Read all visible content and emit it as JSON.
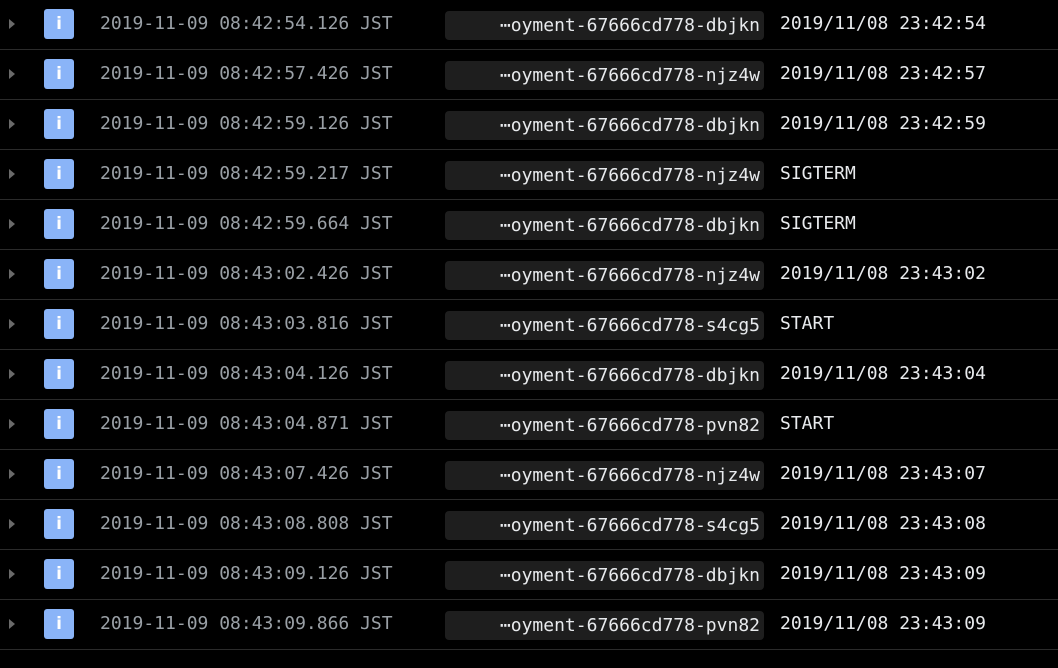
{
  "theme": {
    "background": "#000000",
    "severity_info_color": "#8ab4f8",
    "timestamp_color": "#9aa0a6",
    "text_color": "#e8eaed",
    "chip_background": "#1e1e1e"
  },
  "icons": {
    "expand": "chevron-right-icon",
    "severity": "info-icon"
  },
  "log_entries": [
    {
      "severity_glyph": "i",
      "timestamp": "2019-11-09 08:42:54.126 JST",
      "pod": "⋯oyment-67666cd778-dbjkn",
      "message": "2019/11/08 23:42:54"
    },
    {
      "severity_glyph": "i",
      "timestamp": "2019-11-09 08:42:57.426 JST",
      "pod": "⋯oyment-67666cd778-njz4w",
      "message": "2019/11/08 23:42:57"
    },
    {
      "severity_glyph": "i",
      "timestamp": "2019-11-09 08:42:59.126 JST",
      "pod": "⋯oyment-67666cd778-dbjkn",
      "message": "2019/11/08 23:42:59"
    },
    {
      "severity_glyph": "i",
      "timestamp": "2019-11-09 08:42:59.217 JST",
      "pod": "⋯oyment-67666cd778-njz4w",
      "message": "SIGTERM"
    },
    {
      "severity_glyph": "i",
      "timestamp": "2019-11-09 08:42:59.664 JST",
      "pod": "⋯oyment-67666cd778-dbjkn",
      "message": "SIGTERM"
    },
    {
      "severity_glyph": "i",
      "timestamp": "2019-11-09 08:43:02.426 JST",
      "pod": "⋯oyment-67666cd778-njz4w",
      "message": "2019/11/08 23:43:02"
    },
    {
      "severity_glyph": "i",
      "timestamp": "2019-11-09 08:43:03.816 JST",
      "pod": "⋯oyment-67666cd778-s4cg5",
      "message": "START"
    },
    {
      "severity_glyph": "i",
      "timestamp": "2019-11-09 08:43:04.126 JST",
      "pod": "⋯oyment-67666cd778-dbjkn",
      "message": "2019/11/08 23:43:04"
    },
    {
      "severity_glyph": "i",
      "timestamp": "2019-11-09 08:43:04.871 JST",
      "pod": "⋯oyment-67666cd778-pvn82",
      "message": "START"
    },
    {
      "severity_glyph": "i",
      "timestamp": "2019-11-09 08:43:07.426 JST",
      "pod": "⋯oyment-67666cd778-njz4w",
      "message": "2019/11/08 23:43:07"
    },
    {
      "severity_glyph": "i",
      "timestamp": "2019-11-09 08:43:08.808 JST",
      "pod": "⋯oyment-67666cd778-s4cg5",
      "message": "2019/11/08 23:43:08"
    },
    {
      "severity_glyph": "i",
      "timestamp": "2019-11-09 08:43:09.126 JST",
      "pod": "⋯oyment-67666cd778-dbjkn",
      "message": "2019/11/08 23:43:09"
    },
    {
      "severity_glyph": "i",
      "timestamp": "2019-11-09 08:43:09.866 JST",
      "pod": "⋯oyment-67666cd778-pvn82",
      "message": "2019/11/08 23:43:09"
    }
  ]
}
